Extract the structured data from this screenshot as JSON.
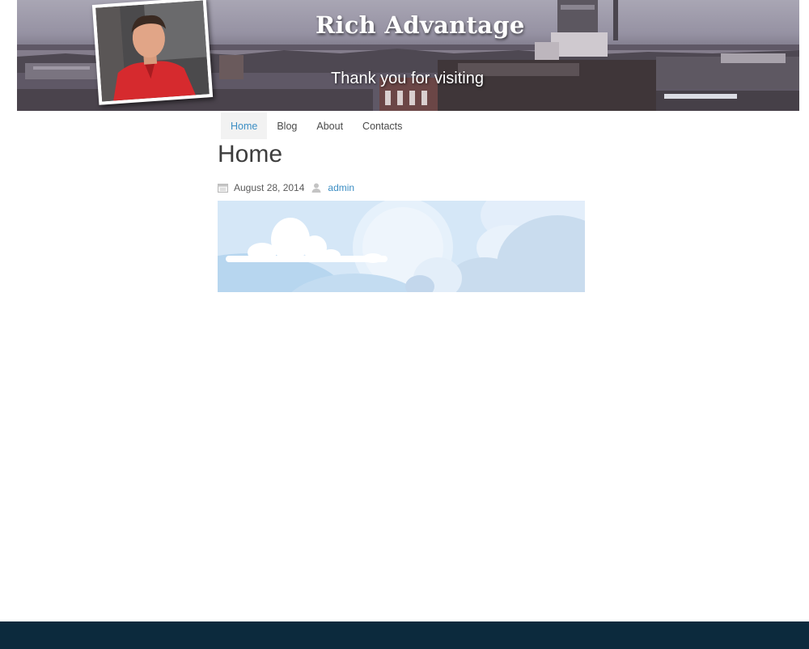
{
  "header": {
    "site_title": "Rich Advantage",
    "tagline": "Thank you for visiting",
    "photo": "portrait-photo"
  },
  "nav": {
    "items": [
      {
        "label": "Home",
        "active": true
      },
      {
        "label": "Blog",
        "active": false
      },
      {
        "label": "About",
        "active": false
      },
      {
        "label": "Contacts",
        "active": false
      }
    ]
  },
  "post": {
    "title": "Home",
    "date": "August 28, 2014",
    "author": "admin",
    "date_icon": "calendar-icon",
    "author_icon": "user-icon",
    "image": "cloud-sky-illustration"
  },
  "colors": {
    "accent": "#3c8ec4",
    "footer": "#0c2a3d",
    "nav_active_bg": "#f2f2f2"
  }
}
